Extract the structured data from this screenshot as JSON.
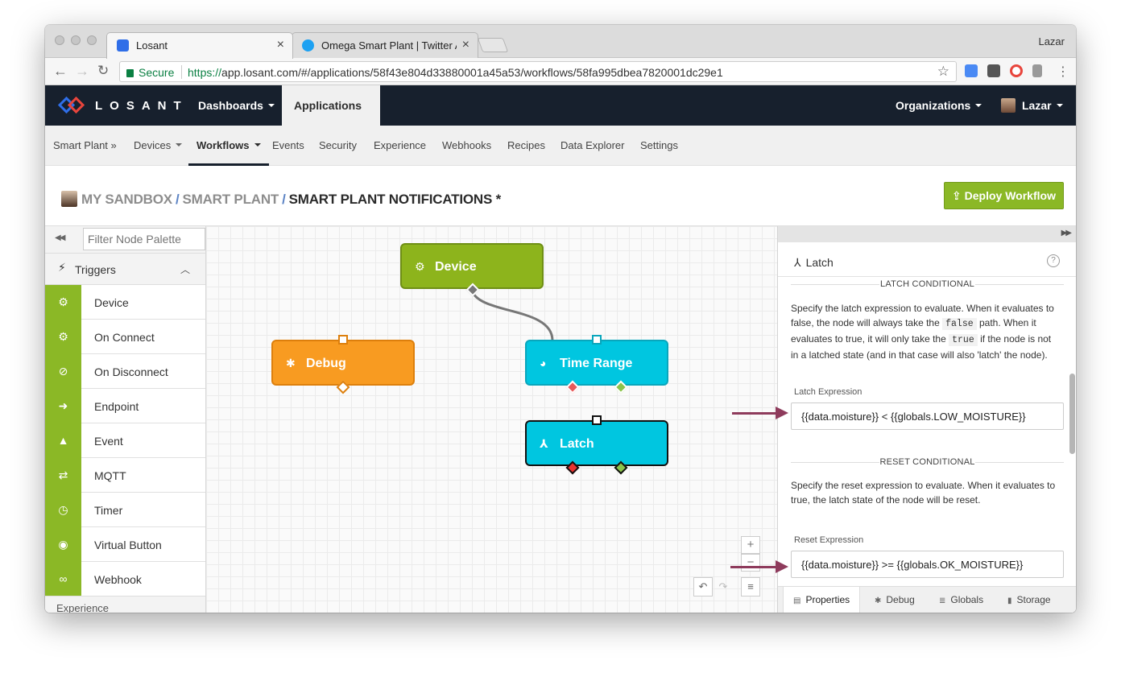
{
  "browser": {
    "tabs": [
      {
        "title": "Losant",
        "active": true
      },
      {
        "title": "Omega Smart Plant | Twitter A",
        "active": false
      }
    ],
    "profile": "Lazar",
    "secure_label": "Secure",
    "url_scheme": "https://",
    "url_rest": "app.losant.com/#/applications/58f43e804d33880001a45a53/workflows/58fa995dbea7820001dc29e1"
  },
  "topnav": {
    "wordmark": "LOSANT",
    "dashboards": "Dashboards",
    "applications": "Applications",
    "organizations": "Organizations",
    "user": "Lazar"
  },
  "subnav": {
    "app": "Smart Plant »",
    "devices": "Devices",
    "workflows": "Workflows",
    "events": "Events",
    "security": "Security",
    "experience": "Experience",
    "webhooks": "Webhooks",
    "recipes": "Recipes",
    "data_explorer": "Data Explorer",
    "settings": "Settings"
  },
  "header": {
    "crumb1": "MY SANDBOX",
    "crumb2": "SMART PLANT",
    "crumb3": "SMART PLANT NOTIFICATIONS *",
    "separator": "/",
    "deploy_label": "Deploy Workflow"
  },
  "palette": {
    "filter_placeholder": "Filter Node Palette",
    "category": "Triggers",
    "items": [
      {
        "label": "Device",
        "icon": "chip-icon"
      },
      {
        "label": "On Connect",
        "icon": "chip-icon"
      },
      {
        "label": "On Disconnect",
        "icon": "chip-off-icon"
      },
      {
        "label": "Endpoint",
        "icon": "endpoint-icon"
      },
      {
        "label": "Event",
        "icon": "warning-icon"
      },
      {
        "label": "MQTT",
        "icon": "arrows-icon"
      },
      {
        "label": "Timer",
        "icon": "timer-icon"
      },
      {
        "label": "Virtual Button",
        "icon": "radio-icon"
      },
      {
        "label": "Webhook",
        "icon": "link-icon"
      }
    ],
    "next_category": "Experience",
    "trigger_color": "#8bb826"
  },
  "canvas": {
    "nodes": {
      "device": {
        "label": "Device",
        "color": "#8db41c"
      },
      "debug": {
        "label": "Debug",
        "color": "#f89b21"
      },
      "time_range": {
        "label": "Time Range",
        "color": "#00c6e0"
      },
      "latch": {
        "label": "Latch",
        "color": "#00c6e0"
      }
    },
    "zoom_in": "+",
    "zoom_out": "−"
  },
  "panel": {
    "title": "Latch",
    "latch_section": "LATCH CONDITIONAL",
    "latch_desc_1": "Specify the latch expression to evaluate. When it evaluates to false, the node will always take the",
    "latch_code_1": "false",
    "latch_desc_2": "path. When it evaluates to true, it will only take the",
    "latch_code_2": "true",
    "latch_desc_3": "if the node is not in a latched state (and in that case will also 'latch' the node).",
    "latch_label": "Latch Expression",
    "latch_value": "{{data.moisture}} < {{globals.LOW_MOISTURE}}",
    "reset_section": "RESET CONDITIONAL",
    "reset_desc": "Specify the reset expression to evaluate. When it evaluates to true, the latch state of the node will be reset.",
    "reset_label": "Reset Expression",
    "reset_value": "{{data.moisture}} >= {{globals.OK_MOISTURE}}",
    "tabs": [
      "Properties",
      "Debug",
      "Globals",
      "Storage"
    ]
  }
}
